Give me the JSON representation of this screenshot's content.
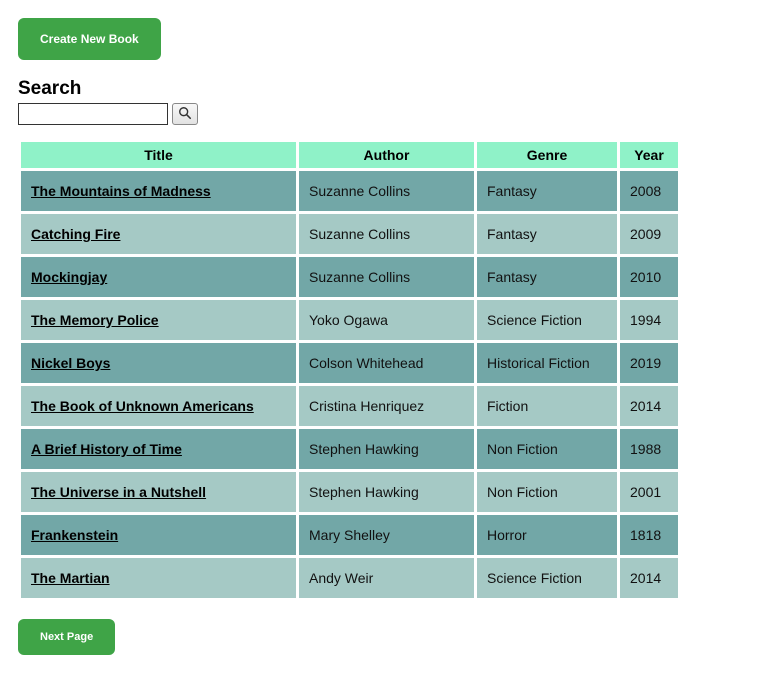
{
  "buttons": {
    "create": "Create New Book",
    "next": "Next Page"
  },
  "search": {
    "label": "Search",
    "value": ""
  },
  "table": {
    "headers": {
      "title": "Title",
      "author": "Author",
      "genre": "Genre",
      "year": "Year"
    },
    "rows": [
      {
        "title": "The Mountains of Madness",
        "author": "Suzanne Collins",
        "genre": "Fantasy",
        "year": "2008"
      },
      {
        "title": "Catching Fire",
        "author": "Suzanne Collins",
        "genre": "Fantasy",
        "year": "2009"
      },
      {
        "title": "Mockingjay",
        "author": "Suzanne Collins",
        "genre": "Fantasy",
        "year": "2010"
      },
      {
        "title": "The Memory Police",
        "author": "Yoko Ogawa",
        "genre": "Science Fiction",
        "year": "1994"
      },
      {
        "title": "Nickel Boys",
        "author": "Colson Whitehead",
        "genre": "Historical Fiction",
        "year": "2019"
      },
      {
        "title": "The Book of Unknown Americans",
        "author": "Cristina Henriquez",
        "genre": "Fiction",
        "year": "2014"
      },
      {
        "title": "A Brief History of Time",
        "author": "Stephen Hawking",
        "genre": "Non Fiction",
        "year": "1988"
      },
      {
        "title": "The Universe in a Nutshell",
        "author": "Stephen Hawking",
        "genre": "Non Fiction",
        "year": "2001"
      },
      {
        "title": "Frankenstein",
        "author": "Mary Shelley",
        "genre": "Horror",
        "year": "1818"
      },
      {
        "title": "The Martian",
        "author": "Andy Weir",
        "genre": "Science Fiction",
        "year": "2014"
      }
    ]
  }
}
